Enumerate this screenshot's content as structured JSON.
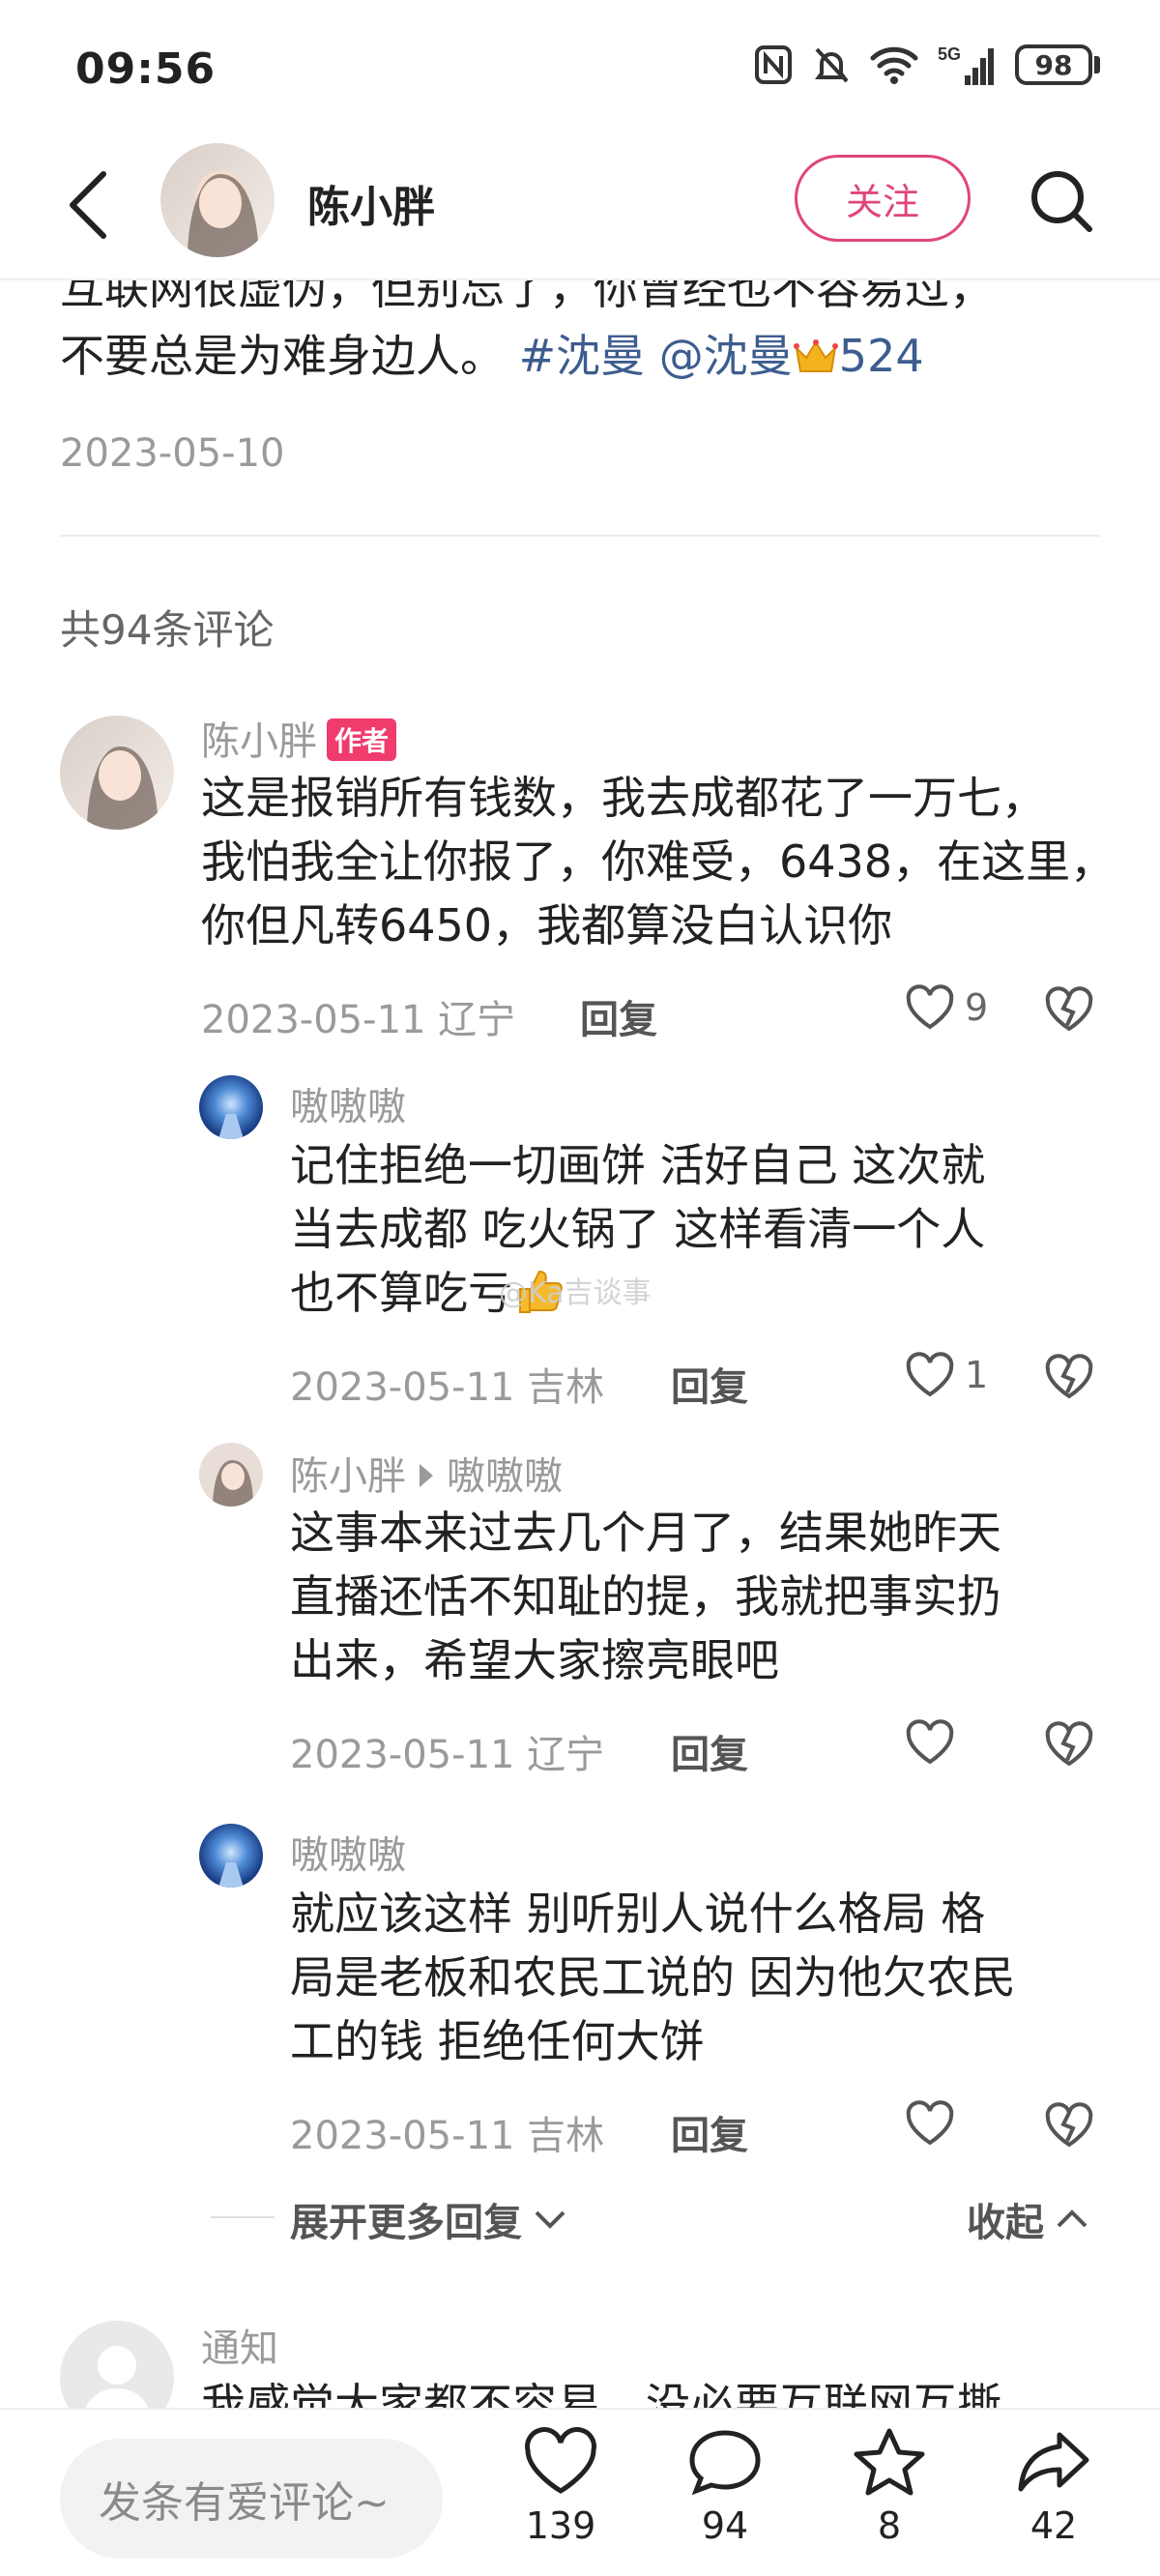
{
  "status_bar": {
    "time": "09:56",
    "battery": "98"
  },
  "header": {
    "username": "陈小胖",
    "follow_label": "关注"
  },
  "post": {
    "cut_line": "互联网很虚伪，但别忘了，你曾经也不容易过，",
    "line_text": "不要总是为难身边人。",
    "tag": "#沈曼",
    "mention": "@沈曼",
    "mention_suffix": "524",
    "date": "2023-05-10"
  },
  "comments_count_label": "共94条评论",
  "comments": [
    {
      "user": "陈小胖",
      "badge": "作者",
      "lines": [
        "这是报销所有钱数，我去成都花了一万七，",
        "我怕我全让你报了，你难受，6438，在这里，",
        "你但凡转6450，我都算没白认识你"
      ],
      "meta": "2023-05-11 辽宁",
      "reply_label": "回复",
      "likes": "9"
    }
  ],
  "replies": [
    {
      "user": "嗷嗷嗷",
      "lines": [
        "记住拒绝一切画饼  活好自己  这次就",
        "当去成都 吃火锅了  这样看清一个人",
        "也不算吃亏"
      ],
      "meta": "2023-05-11 吉林",
      "reply_label": "回复",
      "likes": "1"
    },
    {
      "user": "陈小胖",
      "reply_to": "嗷嗷嗷",
      "lines": [
        "这事本来过去几个月了，结果她昨天",
        "直播还恬不知耻的提，我就把事实扔",
        "出来，希望大家擦亮眼吧"
      ],
      "meta": "2023-05-11 辽宁",
      "reply_label": "回复",
      "likes": ""
    },
    {
      "user": "嗷嗷嗷",
      "lines": [
        "就应该这样  别听别人说什么格局  格",
        "局是老板和农民工说的  因为他欠农民",
        "工的钱  拒绝任何大饼"
      ],
      "meta": "2023-05-11 吉林",
      "reply_label": "回复",
      "likes": ""
    }
  ],
  "more_replies_label": "展开更多回复",
  "collapse_label": "收起",
  "next_comment": {
    "user": "通知",
    "text_cut": "我感觉大家都不容易，没必要互联网互撕"
  },
  "watermark": "@Ka吉谈事",
  "bottom_bar": {
    "input_placeholder": "发条有爱评论~",
    "likes": "139",
    "comments": "94",
    "favorites": "8",
    "shares": "42"
  },
  "colors": {
    "accent": "#e0467c",
    "tag": "#3d5d8f",
    "badge": "#f03b6d"
  }
}
